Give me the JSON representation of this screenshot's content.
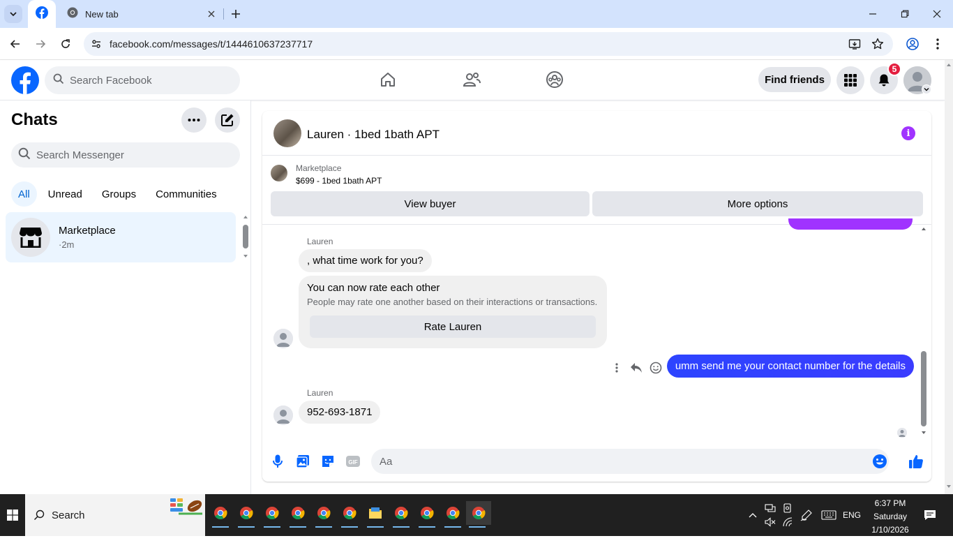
{
  "browser": {
    "tabs": [
      {
        "title": ""
      },
      {
        "title": "New tab"
      }
    ],
    "url": "facebook.com/messages/t/1444610637237717"
  },
  "fb_header": {
    "search_placeholder": "Search Facebook",
    "find_friends_label": "Find friends",
    "notification_count": "5",
    "nav_icons": [
      "home-icon",
      "friends-icon",
      "groups-icon"
    ]
  },
  "sidebar": {
    "title": "Chats",
    "search_placeholder": "Search Messenger",
    "filters": [
      "All",
      "Unread",
      "Groups",
      "Communities"
    ],
    "active_filter": "All",
    "chats": [
      {
        "name": "Marketplace",
        "time": "·2m"
      }
    ]
  },
  "conversation": {
    "title": "Lauren · 1bed 1bath APT",
    "marketplace": {
      "label": "Marketplace",
      "listing": "$699 - 1bed 1bath APT",
      "view_buyer": "View buyer",
      "more_options": "More options"
    },
    "messages": [
      {
        "sender": "Lauren",
        "text": ", what time work for you?"
      },
      {
        "rate_title": "You can now rate each other",
        "rate_sub": "People may rate one another based on their interactions or transactions.",
        "rate_button": "Rate Lauren"
      },
      {
        "sender": "me",
        "text": "umm send me your contact number for the details"
      },
      {
        "sender": "Lauren",
        "text": "952-693-1871"
      }
    ],
    "composer_placeholder": "Aa",
    "accent_color": "#0a3cff"
  },
  "taskbar": {
    "search_label": "Search",
    "language": "ENG",
    "time": "6:37 PM",
    "day": "Saturday",
    "date": "1/10/2026"
  }
}
